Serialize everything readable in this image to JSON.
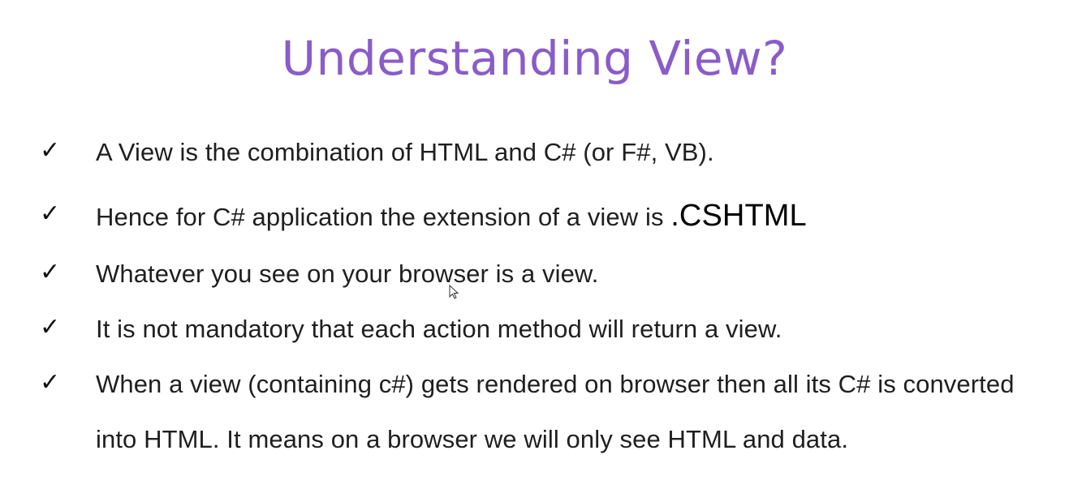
{
  "slide": {
    "title": "Understanding View?",
    "title_color": "#8a5cc8",
    "bullets": [
      {
        "text": "A View is the combination of HTML and C# (or F#, VB)."
      },
      {
        "text": "Hence for C# application the extension of a view is ",
        "emphasis": ".CSHTML"
      },
      {
        "text": "Whatever you see on your browser is a view."
      },
      {
        "text": "It is not mandatory that each action method will return a view."
      },
      {
        "text": "When a view (containing c#) gets rendered on browser then all its C# is converted into HTML. It means on a browser we will only see HTML and data."
      }
    ],
    "bullet_icon": "checkmark-icon",
    "check_glyph": "✓"
  }
}
